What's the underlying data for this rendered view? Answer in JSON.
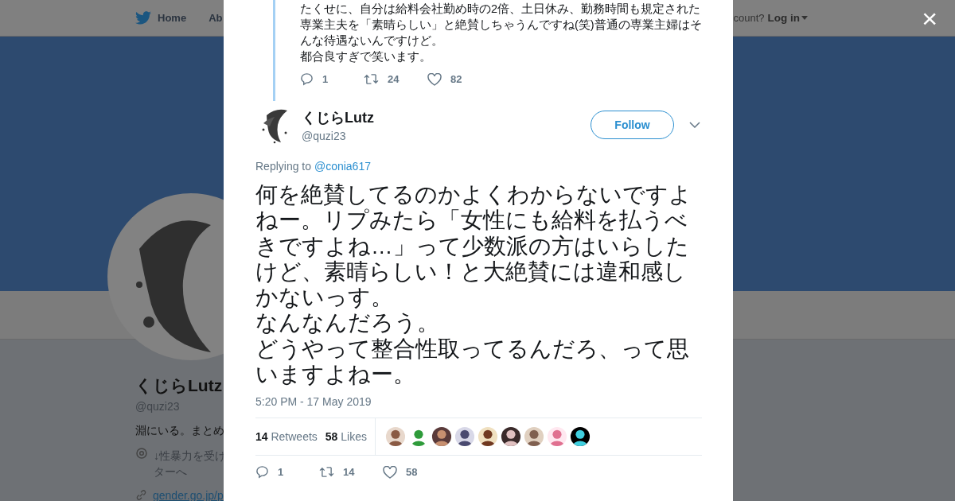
{
  "header": {
    "nav": [
      {
        "label": "Home",
        "kind": "home"
      },
      {
        "label": "Ab",
        "kind": "plain"
      }
    ],
    "account_prompt": "count?",
    "login": "Log in"
  },
  "profile": {
    "name": "くじらLutz",
    "handle": "@quzi23",
    "bio": "淵にいる。まとめ",
    "location": [
      "↓性暴力を受け",
      "ターへ"
    ],
    "link": "gender.go.jp/p"
  },
  "modal": {
    "close": "×",
    "quoted": {
      "paragraphs": [
        "たくせに、自分は給料会社勤め時の2倍、土日休み、勤務時間も規定された専業主夫を「素晴らしい」と絶賛しちゃうんですね(笑)普通の専業主婦はそんな待遇ないんですけど。",
        "都合良すぎで笑います。"
      ],
      "replies": "1",
      "retweets": "24",
      "likes": "82"
    },
    "tweet": {
      "name": "くじらLutz",
      "handle": "@quzi23",
      "follow": "Follow",
      "replying_label": "Replying to",
      "replying_to": "@conia617",
      "paragraphs": [
        "何を絶賛してるのかよくわからないですよねー。リプみたら「女性にも給料を払うべきですよね…」って少数派の方はいらしたけど、素晴らしい！と大絶賛には違和感しかないっす。",
        "なんなんだろう。",
        "どうやって整合性取ってるんだろ、って思いますよねー。"
      ],
      "time": "5:20 PM - 17 May 2019",
      "retweet_count": "14",
      "retweet_label": "Retweets",
      "like_count": "58",
      "like_label": "Likes",
      "replies": "1",
      "retweets": "14",
      "likes": "58"
    }
  }
}
